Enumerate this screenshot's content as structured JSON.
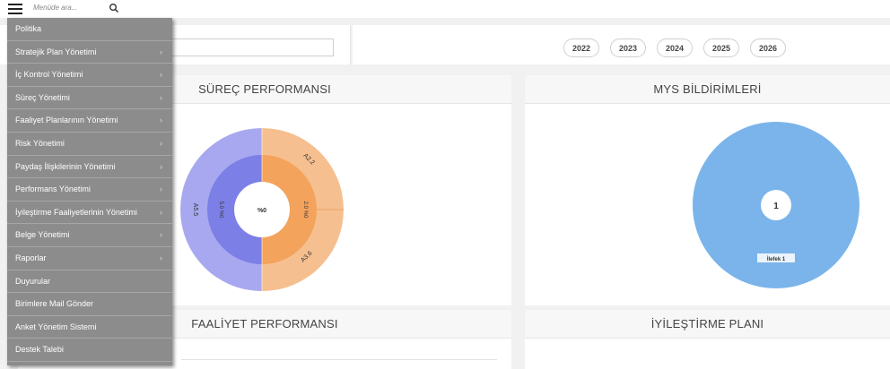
{
  "search": {
    "placeholder": "Menüde ara..."
  },
  "years": [
    "2022",
    "2023",
    "2024",
    "2025",
    "2026"
  ],
  "cards": {
    "surec": {
      "title": "SÜREÇ PERFORMANSI"
    },
    "mys": {
      "title": "MYS BİLDİRİMLERİ"
    },
    "faaliyet": {
      "title": "FAALİYET PERFORMANSI"
    },
    "iyilestirme": {
      "title": "İYİLEŞTİRME PLANI"
    }
  },
  "surec_chart": {
    "center_label": "%0",
    "labels": {
      "outer_left": "A5.5",
      "outer_right_top": "A2.2",
      "outer_right_bottom": "A3.6",
      "inner_left": "5.0 %0",
      "inner_right": "2.0 %0"
    }
  },
  "mys_chart": {
    "center_label": "1",
    "slice_label": "İlefek 1"
  },
  "colors": {
    "menu_bg": "#8c8c8c",
    "purple_outer": "#a7a8ef",
    "purple_inner": "#7c7fe6",
    "orange_outer": "#f6bf8f",
    "orange_inner": "#f4a35c",
    "blue": "#7ab4ea"
  },
  "menu": {
    "items": [
      {
        "label": "Politika",
        "chevron": ""
      },
      {
        "label": "Stratejik Plan Yönetimi",
        "chevron": "›"
      },
      {
        "label": "İç Kontrol Yönetimi",
        "chevron": "›"
      },
      {
        "label": "Süreç Yönetimi",
        "chevron": "›"
      },
      {
        "label": "Faaliyet Planlarının Yönetimi",
        "chevron": "›"
      },
      {
        "label": "Risk Yönetimi",
        "chevron": "›"
      },
      {
        "label": "Paydaş İlişkilerinin Yönetimi",
        "chevron": "›"
      },
      {
        "label": "Performans Yönetimi",
        "chevron": "›"
      },
      {
        "label": "İyileştirme Faaliyetlerinin Yönetimi",
        "chevron": "›"
      },
      {
        "label": "Belge Yönetimi",
        "chevron": "›"
      },
      {
        "label": "Raporlar",
        "chevron": "›"
      },
      {
        "label": "Duyurular",
        "chevron": ""
      },
      {
        "label": "Birimlere Mail Gönder",
        "chevron": ""
      },
      {
        "label": "Anket Yönetim Sistemi",
        "chevron": ""
      },
      {
        "label": "Destek Talebi",
        "chevron": ""
      }
    ]
  }
}
